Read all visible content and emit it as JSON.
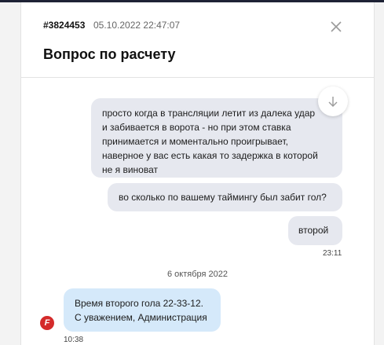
{
  "ticket": {
    "id": "#3824453",
    "datetime": "05.10.2022 22:47:07",
    "title": "Вопрос по расчету"
  },
  "messages": [
    {
      "author": "user",
      "lines": [
        "просто когда в трансляции летит из далека удар",
        "и забивается в ворота - но при этом ставка",
        "принимается и моментально проигрывает,",
        "наверное у вас есть какая то задержка в которой",
        "не я виноват"
      ]
    },
    {
      "author": "user",
      "text": "во сколько по вашему таймингу был забит гол?"
    },
    {
      "author": "user",
      "text": "второй",
      "time": "23:11"
    }
  ],
  "date_separator": "6 октября 2022",
  "admin_message": {
    "lines": [
      "Время второго гола 22-33-12.",
      "С уважением, Администрация"
    ],
    "time": "10:38",
    "avatar_letter": "F"
  },
  "icons": {
    "close": "close-icon",
    "scroll": "arrow-down-icon",
    "avatar": "brand-logo-icon"
  },
  "colors": {
    "user_bubble": "#e6e8ef",
    "admin_bubble": "#d5e9fa",
    "avatar": "#d42b2b",
    "topbar": "#1e2235"
  }
}
